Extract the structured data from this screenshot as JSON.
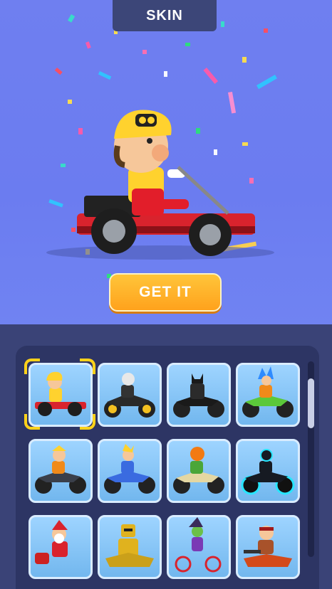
{
  "header": {
    "title": "SKIN"
  },
  "hero": {
    "button_label": "GET IT",
    "character_icon": "kart-racer-yellow-cap"
  },
  "skins": [
    {
      "icon": "kart-racer-yellow-cap",
      "selected": true
    },
    {
      "icon": "skull-rider-motorbike",
      "selected": false
    },
    {
      "icon": "batman-rider-motorbike",
      "selected": false
    },
    {
      "icon": "saiyan-rider-green-bike",
      "selected": false
    },
    {
      "icon": "ninja-rider-motorbike",
      "selected": false
    },
    {
      "icon": "super-rider-blue-bike",
      "selected": false
    },
    {
      "icon": "pumpkin-rider-dirtbike",
      "selected": false
    },
    {
      "icon": "tron-rider-neon-bike",
      "selected": false
    },
    {
      "icon": "santa-rider-motorbike",
      "selected": false
    },
    {
      "icon": "robot-rider-gold-bike",
      "selected": false
    },
    {
      "icon": "witch-rider-bicycle",
      "selected": false
    },
    {
      "icon": "bandit-rider-motorbike",
      "selected": false
    }
  ],
  "colors": {
    "accent": "#ffd21a",
    "button": "#ffa21c",
    "panel": "#2d3564"
  }
}
